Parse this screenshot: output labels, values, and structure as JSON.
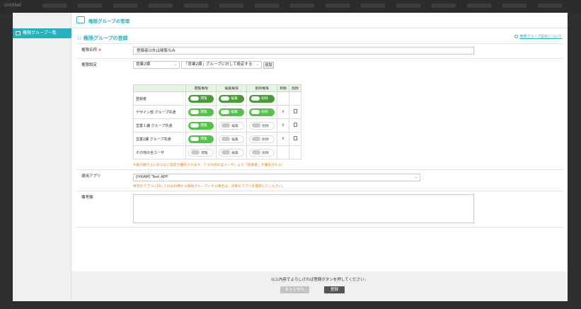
{
  "browser": {
    "title": "Untitled"
  },
  "sidebar": {
    "items": [
      {
        "label": "権限グループ一覧"
      }
    ]
  },
  "header": {
    "title": "権限グループの管理"
  },
  "section": {
    "title": "権限グループの登録",
    "help_link": "権限グループ設定について"
  },
  "form": {
    "name_label": "権限名称",
    "required_mark": "※",
    "name_value": "登録者以外は閲覧のみ",
    "perm_label": "権限設定",
    "group_select": "営業2課",
    "scope_select": "「営業2課」グループに対して設定する",
    "add_button": "追加",
    "table_headers": {
      "view": "閲覧権限",
      "edit": "編集権限",
      "delete": "削除権限",
      "move": "移動",
      "remove": "削除"
    },
    "rows": [
      {
        "name": "登録者",
        "view": "閲覧",
        "edit": "編集",
        "del": "削除",
        "move": ""
      },
      {
        "name": "デザイン部 グループ共通",
        "view": "閲覧",
        "edit": "編集",
        "del": "削除",
        "move": "⇕"
      },
      {
        "name": "営業１課 グループ共通",
        "view": "閲覧",
        "edit": "編集",
        "del": "削除",
        "move": "⇕"
      },
      {
        "name": "営業2課 グループ共通",
        "view": "閲覧",
        "edit": "編集",
        "del": "削除",
        "move": "⇕"
      },
      {
        "name": "その他の全ユーザ",
        "view": "閲覧",
        "edit": "編集",
        "del": "削除",
        "move": ""
      }
    ],
    "perm_note": "※表の順が上にあるほど設定が優先されます。（「その他の全ユーザ」より「登録者」が優先される）",
    "app_label": "適用アプリ",
    "app_select": "[HXAM] Test APP",
    "app_note": "特定のアプリに対してのみ利用する権限グループにする場合は、対象のアプリを選択してください。",
    "memo_label": "備考欄"
  },
  "footer": {
    "message": "以上内容でよろしければ登録ボタンを押してください。",
    "cancel": "キャンセル",
    "register": "登録"
  },
  "colors": {
    "accent": "#27b1bf",
    "toggle_on": "#53c447",
    "toggle_on_dark": "#4a9a3a",
    "note": "#e0821e"
  }
}
